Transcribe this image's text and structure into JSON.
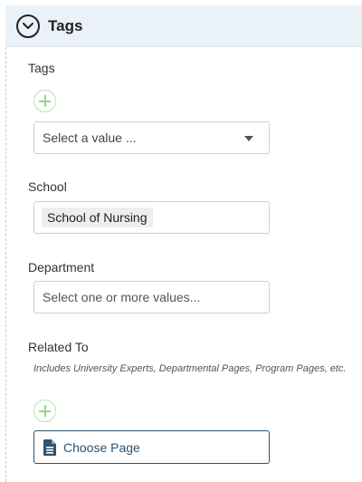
{
  "section": {
    "title": "Tags",
    "toggle_icon": "chevron-down-circle-icon"
  },
  "fields": {
    "tags": {
      "label": "Tags",
      "add_icon": "plus-circle-icon",
      "select_placeholder": "Select a value ..."
    },
    "school": {
      "label": "School",
      "selected": [
        "School of Nursing"
      ]
    },
    "department": {
      "label": "Department",
      "placeholder": "Select one or more values..."
    },
    "related_to": {
      "label": "Related To",
      "help": "Includes University Experts, Departmental Pages, Program Pages, etc.",
      "add_icon": "plus-circle-icon",
      "choose_label": "Choose Page",
      "choose_icon": "document-icon"
    }
  },
  "colors": {
    "header_bg": "#eaf1f9",
    "add_green": "#95d78a",
    "button_blue": "#2e5370"
  }
}
